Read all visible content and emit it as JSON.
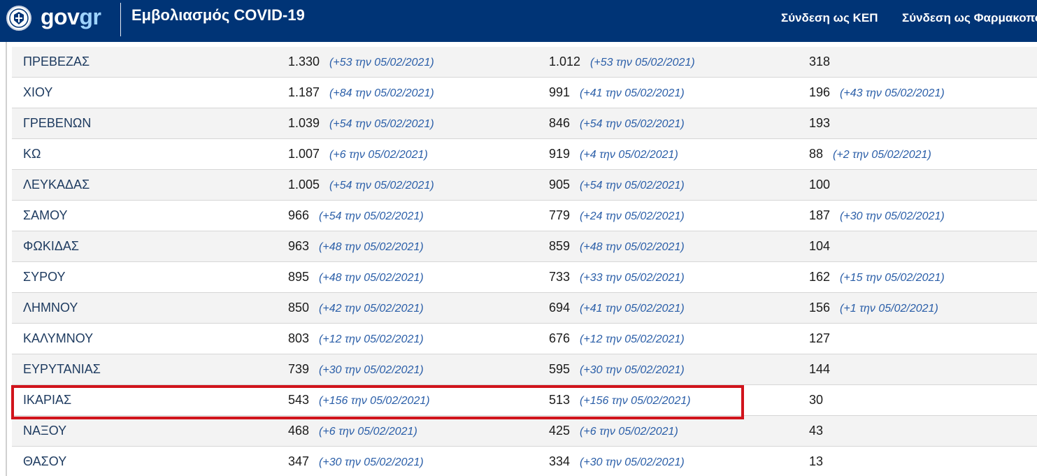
{
  "header": {
    "logo_main": "gov",
    "logo_accent": "gr",
    "title": "Εμβολιασμός COVID-19",
    "nav": {
      "kep": "Σύνδεση ως ΚΕΠ",
      "pharmacy": "Σύνδεση ως Φαρμακοποιός"
    },
    "colors": {
      "background": "#003476",
      "accent": "#9fd4ff"
    }
  },
  "table": {
    "rows": [
      {
        "region": "ΠΡΕΒΕΖΑΣ",
        "c1": "1.330",
        "d1": "(+53 την 05/02/2021)",
        "c2": "1.012",
        "d2": "(+53 την 05/02/2021)",
        "c3": "318",
        "d3": ""
      },
      {
        "region": "ΧΙΟΥ",
        "c1": "1.187",
        "d1": "(+84 την 05/02/2021)",
        "c2": "991",
        "d2": "(+41 την 05/02/2021)",
        "c3": "196",
        "d3": "(+43 την 05/02/2021)"
      },
      {
        "region": "ΓΡΕΒΕΝΩΝ",
        "c1": "1.039",
        "d1": "(+54 την 05/02/2021)",
        "c2": "846",
        "d2": "(+54 την 05/02/2021)",
        "c3": "193",
        "d3": ""
      },
      {
        "region": "ΚΩ",
        "c1": "1.007",
        "d1": "(+6 την 05/02/2021)",
        "c2": "919",
        "d2": "(+4 την 05/02/2021)",
        "c3": "88",
        "d3": "(+2 την 05/02/2021)"
      },
      {
        "region": "ΛΕΥΚΑΔΑΣ",
        "c1": "1.005",
        "d1": "(+54 την 05/02/2021)",
        "c2": "905",
        "d2": "(+54 την 05/02/2021)",
        "c3": "100",
        "d3": ""
      },
      {
        "region": "ΣΑΜΟΥ",
        "c1": "966",
        "d1": "(+54 την 05/02/2021)",
        "c2": "779",
        "d2": "(+24 την 05/02/2021)",
        "c3": "187",
        "d3": "(+30 την 05/02/2021)"
      },
      {
        "region": "ΦΩΚΙΔΑΣ",
        "c1": "963",
        "d1": "(+48 την 05/02/2021)",
        "c2": "859",
        "d2": "(+48 την 05/02/2021)",
        "c3": "104",
        "d3": ""
      },
      {
        "region": "ΣΥΡΟΥ",
        "c1": "895",
        "d1": "(+48 την 05/02/2021)",
        "c2": "733",
        "d2": "(+33 την 05/02/2021)",
        "c3": "162",
        "d3": "(+15 την 05/02/2021)"
      },
      {
        "region": "ΛΗΜΝΟΥ",
        "c1": "850",
        "d1": "(+42 την 05/02/2021)",
        "c2": "694",
        "d2": "(+41 την 05/02/2021)",
        "c3": "156",
        "d3": "(+1 την 05/02/2021)"
      },
      {
        "region": "ΚΑΛΥΜΝΟΥ",
        "c1": "803",
        "d1": "(+12 την 05/02/2021)",
        "c2": "676",
        "d2": "(+12 την 05/02/2021)",
        "c3": "127",
        "d3": ""
      },
      {
        "region": "ΕΥΡΥΤΑΝΙΑΣ",
        "c1": "739",
        "d1": "(+30 την 05/02/2021)",
        "c2": "595",
        "d2": "(+30 την 05/02/2021)",
        "c3": "144",
        "d3": ""
      },
      {
        "region": "ΙΚΑΡΙΑΣ",
        "c1": "543",
        "d1": "(+156 την 05/02/2021)",
        "c2": "513",
        "d2": "(+156 την 05/02/2021)",
        "c3": "30",
        "d3": ""
      },
      {
        "region": "ΝΑΞΟΥ",
        "c1": "468",
        "d1": "(+6 την 05/02/2021)",
        "c2": "425",
        "d2": "(+6 την 05/02/2021)",
        "c3": "43",
        "d3": ""
      },
      {
        "region": "ΘΑΣΟΥ",
        "c1": "347",
        "d1": "(+30 την 05/02/2021)",
        "c2": "334",
        "d2": "(+30 την 05/02/2021)",
        "c3": "13",
        "d3": ""
      }
    ]
  },
  "annotation": {
    "highlight_color": "#d1141c"
  }
}
